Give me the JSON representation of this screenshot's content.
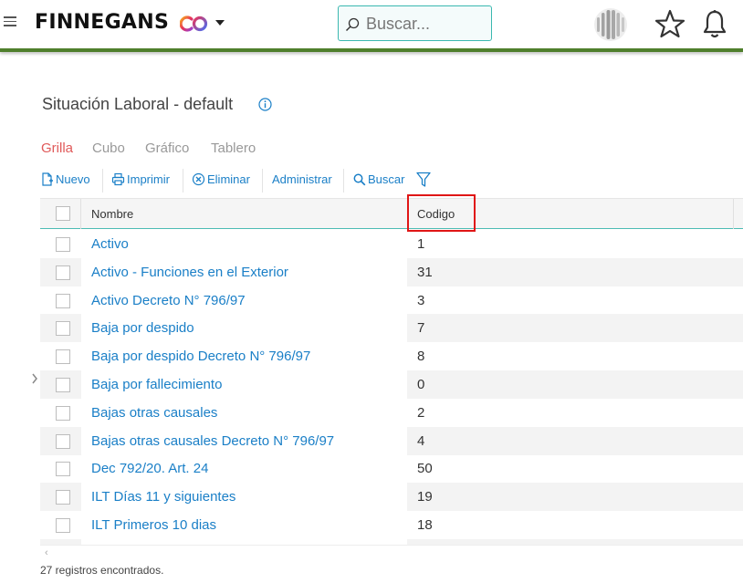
{
  "header": {
    "brand": "FINNEGANS",
    "search_placeholder": "Buscar..."
  },
  "page": {
    "title": "Situación Laboral - default"
  },
  "tabs": [
    {
      "label": "Grilla",
      "active": true
    },
    {
      "label": "Cubo",
      "active": false
    },
    {
      "label": "Gráfico",
      "active": false
    },
    {
      "label": "Tablero",
      "active": false
    }
  ],
  "toolbar": {
    "nuevo": "Nuevo",
    "imprimir": "Imprimir",
    "eliminar": "Eliminar",
    "administrar": "Administrar",
    "buscar": "Buscar"
  },
  "grid": {
    "columns": {
      "nombre": "Nombre",
      "codigo": "Codigo"
    },
    "rows": [
      {
        "nombre": "Activo",
        "codigo": "1"
      },
      {
        "nombre": "Activo - Funciones en el Exterior",
        "codigo": "31"
      },
      {
        "nombre": "Activo Decreto N° 796/97",
        "codigo": "3"
      },
      {
        "nombre": "Baja por despido",
        "codigo": "7"
      },
      {
        "nombre": "Baja por despido Decreto N° 796/97",
        "codigo": "8"
      },
      {
        "nombre": "Baja por fallecimiento",
        "codigo": "0"
      },
      {
        "nombre": "Bajas otras causales",
        "codigo": "2"
      },
      {
        "nombre": "Bajas otras causales Decreto N° 796/97",
        "codigo": "4"
      },
      {
        "nombre": "Dec 792/20. Art. 24",
        "codigo": "50"
      },
      {
        "nombre": "ILT Días 11 y siguientes",
        "codigo": "19"
      },
      {
        "nombre": "ILT Primeros 10 dias",
        "codigo": "18"
      }
    ]
  },
  "footer": {
    "count": "27 registros encontrados."
  },
  "colors": {
    "accent": "#1a7fc7",
    "active_tab": "#e05a5a",
    "header_bar": "#4f7f2c",
    "highlight": "#e01616"
  }
}
